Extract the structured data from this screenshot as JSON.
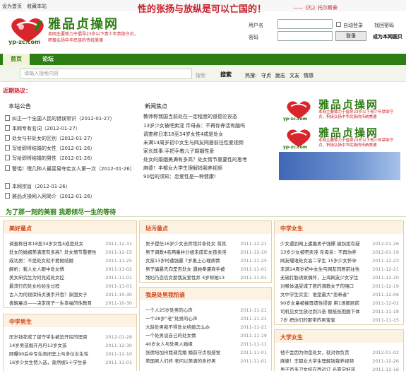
{
  "topbar": {
    "set_home": "设为首页",
    "bookmark": "收藏本站"
  },
  "slogan": {
    "text": "性的张扬与放纵是可以亡国的！",
    "signature": "——《礼》托尔斯泰"
  },
  "logo": {
    "name": "雅品贞操网",
    "url": "yp-zc.com",
    "desc": "本网主要致力于倡导23岁以下青少年禁欲守贞，积极弘扬中华民族的传统美德"
  },
  "login": {
    "username_label": "用户名",
    "password_label": "密码",
    "auto_login": "自动登录",
    "forgot": "找回密码",
    "login_button": "登录",
    "join": "成为本网圆贝"
  },
  "nav": {
    "tabs": [
      {
        "label": "首页"
      },
      {
        "label": "论坛"
      }
    ]
  },
  "search": {
    "placeholder": "请输入搜索内容",
    "label": "搜索",
    "button": "搜索",
    "hot_label": "热搜:",
    "hot_keywords": [
      "守贞",
      "励志",
      "文友",
      "情感"
    ]
  },
  "recent_hot": "近期热议：",
  "notice": {
    "title": "本站公告",
    "items": [
      {
        "text": "纠正一个全国人民的错误常识",
        "date": "（2012-01-27）"
      },
      {
        "text": "本网专有名词",
        "date": "（2012-01-27）"
      },
      {
        "text": "处女与非处女的区别",
        "date": "（2012-01-27）"
      },
      {
        "text": "写给即将结婚的女性",
        "date": "（2012-01-26）"
      },
      {
        "text": "写给即将结婚的男性",
        "date": "（2012-01-26）"
      },
      {
        "text": "警惕！嘿几种人最容易夺走女人第一次",
        "date": "（2012-01-26）"
      },
      {
        "text": "本网宗旨",
        "date": "（2012-01-26）"
      },
      {
        "text": "雅品贞操网入网简介",
        "date": "（2012-01-26）"
      }
    ]
  },
  "focus": {
    "title": "新闻焦点",
    "items": [
      "教师称我国当前处在一定程度的道德沦丧态",
      "13岁少女被吧卖淫 斥母亲：不再你养活有脑吗",
      "调查称日本18至34岁女性4成是处女",
      "未满14周岁初中女生与网友同居前往性爱视频",
      "家长故事:手把手教儿子婚姻性爱",
      "处女的婚姻美满有多高？处女情节重要性的思考",
      "麻婆！丰都女大学生理解钱我养视频",
      "90后的须知：恋爱性是一种健康!"
    ]
  },
  "motto": "为了那一刻的美丽 我愿倾尽一生的等待",
  "panels": {
    "youth": {
      "title": "美好童贞",
      "items": [
        {
          "text": "调查称日本18至34岁女性4成是处女",
          "date": "2011-12-31"
        },
        {
          "text": "处女的婚姻美满度有多高？处女情节重要性",
          "date": "2011-12-15"
        },
        {
          "text": "成功男：不是处女就不要她结婚",
          "date": "2011-11-25"
        },
        {
          "text": "解析：我人女人眼中处女情",
          "date": "2011-11-02"
        },
        {
          "text": "美女研究生为何竞成处女控",
          "date": "2011-11-01"
        },
        {
          "text": "最流行的处女检验全过程",
          "date": "2011-11-01"
        },
        {
          "text": "古人为何视保持贞操手开吞？家国女子",
          "date": "2011-10-30"
        },
        {
          "text": "善解童贞——决定孩子一生幸福的性教育",
          "date": "2011-10-30"
        }
      ]
    },
    "hukou": {
      "title": "玷污童贞",
      "items": [
        {
          "text": "男子提任16岁少女去宾馆并非处女 将其",
          "date": "2011-12-21"
        },
        {
          "text": "男子调教4名两童并分组未成年女孩卖淫",
          "date": "2011-12-10"
        },
        {
          "text": "女孩13岁时遭强暴 7岁患上心理病情",
          "date": "2011-11-25"
        },
        {
          "text": "男子骗暴先向是否处女 遇她拳遭商手被",
          "date": "2011-11-01"
        },
        {
          "text": "残妇乃恋信女朋我友爱性并 4岁帮她13",
          "date": "2011-11-01"
        }
      ]
    },
    "wait": {
      "title": "我是处男我怕谁",
      "items": [
        {
          "text": "一个人25岁处男的心声",
          "date": "2011-11-21"
        },
        {
          "text": "一个28岁“老”处男的心声",
          "date": "2011-11-21"
        },
        {
          "text": "大龄处男我不得处女结婚怎么办",
          "date": "2011-11-21"
        },
        {
          "text": "一个处男谈自己的处女情",
          "date": "2011-11-19"
        },
        {
          "text": "40岁女人与处男人婚缘",
          "date": "2011-11-11"
        },
        {
          "text": "张德培加州我调完婚 婚前守贞视感觉",
          "date": "2011-11-01"
        },
        {
          "text": "美国男人们终 老问以美满的多好男",
          "date": "2011-11-01"
        },
        {
          "text": "老夫妇开爱法的情理结在生 全球为10",
          "date": "2011-10-31"
        }
      ]
    },
    "zhong_boy": {
      "title": "中学男生",
      "items": [
        {
          "text": "压岁钱花成了留守学生被追开房的理资",
          "date": "2012-01-28"
        },
        {
          "text": "14岁男孩掘开丹丹13岁女孩",
          "date": "2011-12-30"
        },
        {
          "text": "网曝90后中专生闹闭室上与多位女生性",
          "date": "2011-12-10"
        },
        {
          "text": "16岁少女生赞入选，竟然被5十学生参",
          "date": "2011-11-01"
        },
        {
          "text": "青少年性知识不容忽视",
          "date": "2011-11-01"
        }
      ]
    },
    "zhong_girl": {
      "title": "中学女生",
      "items": [
        {
          "text": "少女遇到网上遭摄男子强嫖 被拐拒有疑",
          "date": "2012-01-26"
        },
        {
          "text": "13岁少女被吧卖淫 斥母亲：不再你养",
          "date": "2012-01-19"
        },
        {
          "text": "网友曝谁处女高二学生 15岁少女怀孕",
          "date": "2011-12-23"
        },
        {
          "text": "未满14周岁初中女生与网友同居前往性",
          "date": "2011-12-21"
        },
        {
          "text": "无锡打胎诱致偶怀，上海网友少女学生",
          "date": "2011-12-20"
        },
        {
          "text": "对嗽体温受城了若的调教女子的强口",
          "date": "2011-12-19"
        },
        {
          "text": "文中学生实变：谁是最大“悲希者”",
          "date": "2011-12-06"
        },
        {
          "text": "90岁女童被摧辱遗性侵害 用1场那顾前",
          "date": "2011-12-02"
        },
        {
          "text": "司机见女生放过到兴奋 摁抵抵抱膛下体",
          "date": "2011-11-18"
        },
        {
          "text": "7岁 把你们的那带的男宝宝",
          "date": "2011-11-15"
        }
      ]
    },
    "college": {
      "title": "大学女生",
      "items": [
        {
          "text": "他不会因为你是处女，就对你负责",
          "date": "2012-01-02"
        },
        {
          "text": "麻婆！丰都女大学生理解钱我养视频",
          "date": "2011-12-26"
        },
        {
          "text": "男子百多卫女校在西远订 光靠学好孩",
          "date": "2011-12-16"
        }
      ]
    }
  }
}
